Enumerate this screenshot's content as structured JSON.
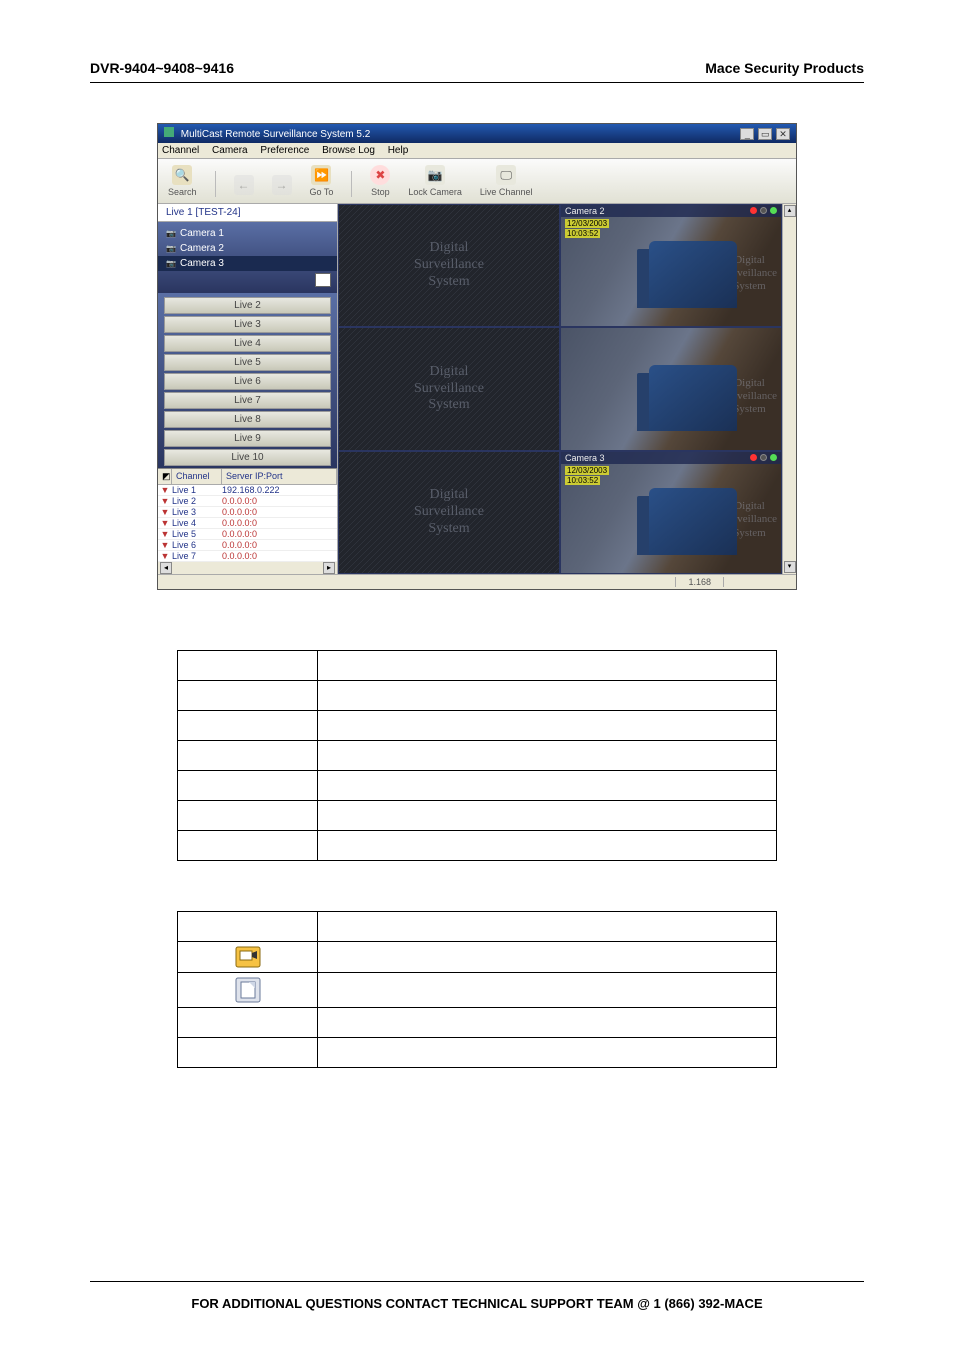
{
  "header": {
    "left": "DVR-9404~9408~9416",
    "right": "Mace Security Products"
  },
  "app": {
    "title": "MultiCast Remote Surveillance System 5.2",
    "menu": [
      "Channel",
      "Camera",
      "Preference",
      "Browse Log",
      "Help"
    ],
    "toolbar": {
      "search": "Search",
      "back": "",
      "forward": "",
      "goto": "Go To",
      "stop": "Stop",
      "lock": "Lock Camera",
      "live": "Live Channel"
    },
    "tab": "Live 1 [TEST-24]",
    "tree": [
      "Camera 1",
      "Camera 2",
      "Camera 3"
    ],
    "liveList": [
      "Live 2",
      "Live 3",
      "Live 4",
      "Live 5",
      "Live 6",
      "Live 7",
      "Live 8",
      "Live 9",
      "Live 10"
    ],
    "channelHeader": {
      "col1": "",
      "col2": "Channel",
      "col3": "Server IP:Port"
    },
    "channels": [
      {
        "name": "Live 1",
        "ip": "192.168.0.222"
      },
      {
        "name": "Live 2",
        "ip": "0.0.0.0:0"
      },
      {
        "name": "Live 3",
        "ip": "0.0.0.0:0"
      },
      {
        "name": "Live 4",
        "ip": "0.0.0.0:0"
      },
      {
        "name": "Live 5",
        "ip": "0.0.0.0:0"
      },
      {
        "name": "Live 6",
        "ip": "0.0.0.0:0"
      },
      {
        "name": "Live 7",
        "ip": "0.0.0.0:0"
      }
    ],
    "camLabels": {
      "cam2": "Camera 2",
      "cam3": "Camera 3"
    },
    "stamp_date": "12/03/2003",
    "stamp_time": "10:03:52",
    "watermark_top": "Digital",
    "watermark_mid": "Surveillance",
    "watermark_bot": "System",
    "status": "1.168"
  },
  "table1": {
    "rows": [
      "",
      "",
      "",
      "",
      "",
      "",
      ""
    ]
  },
  "table2": {
    "rows": [
      "",
      "icon1",
      "icon2",
      "",
      ""
    ]
  },
  "footer": "FOR ADDITIONAL QUESTIONS CONTACT TECHNICAL SUPPORT TEAM @ 1 (866) 392-MACE"
}
